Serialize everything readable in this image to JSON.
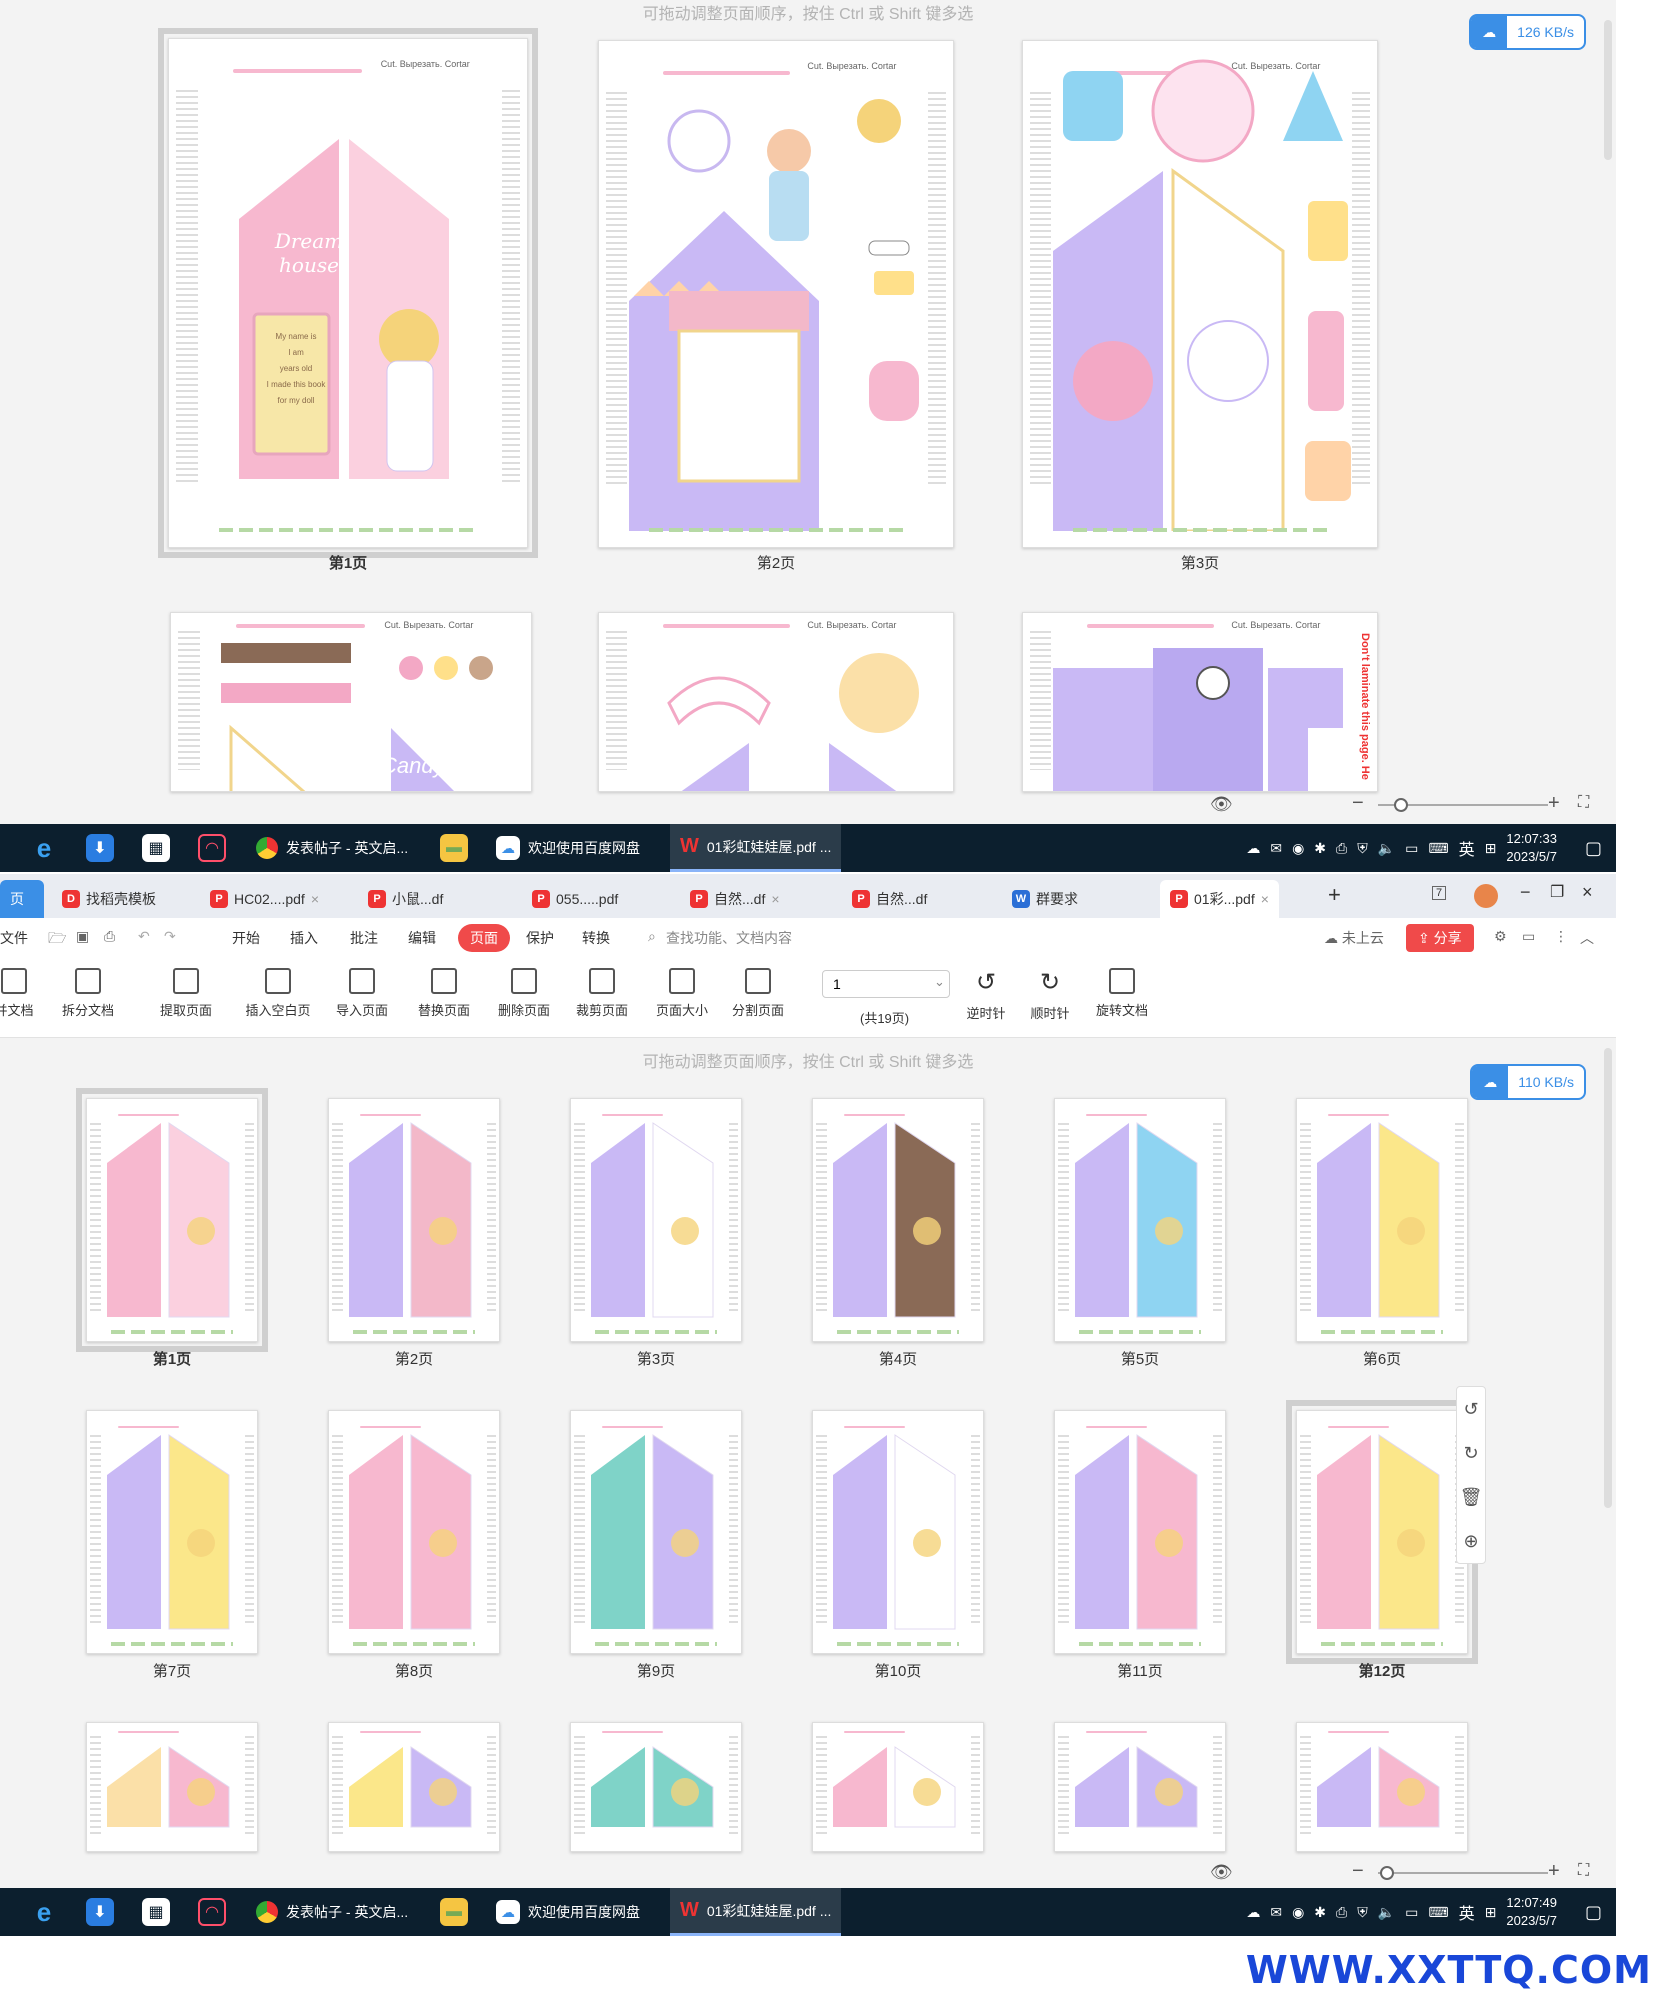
{
  "hint_text": "可拖动调整页面顺序，按住 Ctrl 或 Shift 键多选",
  "speed_top": "126 KB/s",
  "speed_bottom": "110 KB/s",
  "pages_top_row1": [
    "第1页",
    "第2页",
    "第3页"
  ],
  "pages_grid": [
    "第1页",
    "第2页",
    "第3页",
    "第4页",
    "第5页",
    "第6页",
    "第7页",
    "第8页",
    "第9页",
    "第10页",
    "第11页",
    "第12页"
  ],
  "page_header_text": "Cut. Вырезать. Cortar",
  "page_side_text": "All rights reserved. Commercial use is prohibited",
  "page_right_text": "Laminate this page. Заламинируйте эту страницу. Plastificar esta página",
  "page_right_text_alt": "Don't laminate this page. Не",
  "page1_title": "Dream house",
  "page1_card": [
    "My name is",
    "I am",
    "years old",
    "I made this book for my doll"
  ],
  "page4_candy": "Candy",
  "taskbar": {
    "apps": [
      "发表帖子 - 英文启...",
      "欢迎使用百度网盘",
      "01彩虹娃娃屋.pdf ..."
    ],
    "ime": "英",
    "time": "12:07:33",
    "time2": "12:07:49",
    "date": "2023/5/7"
  },
  "tabs": [
    {
      "label": "页",
      "color": "#3b8fe6"
    },
    {
      "label": "找稻壳模板",
      "color": "#e33"
    },
    {
      "label": "HC02....pdf",
      "color": "#e33"
    },
    {
      "label": "小鼠...df",
      "color": "#e33"
    },
    {
      "label": "055.....pdf",
      "color": "#e33"
    },
    {
      "label": "自然...df",
      "color": "#e33"
    },
    {
      "label": "自然...df",
      "color": "#e33"
    },
    {
      "label": "群要求",
      "color": "#2b6fd6"
    },
    {
      "label": "01彩...pdf",
      "color": "#e33"
    }
  ],
  "menu": [
    "文件",
    "开始",
    "插入",
    "批注",
    "编辑",
    "页面",
    "保护",
    "转换"
  ],
  "search_placeholder": "查找功能、文档内容",
  "cloud_label": "未上云",
  "share_label": "分享",
  "ribbon": [
    "并文档",
    "拆分文档",
    "提取页面",
    "插入空白页",
    "导入页面",
    "替换页面",
    "删除页面",
    "裁剪页面",
    "页面大小",
    "分割页面",
    "逆时针",
    "顺时针",
    "旋转文档"
  ],
  "page_input": "1",
  "page_total": "(共19页)",
  "watermark": "WWW.XXTTQ.COM",
  "colors": {
    "accent": "#3b8fe6",
    "share": "#f04a4a",
    "taskbar": "#0c1f2e",
    "pink": "#f7b8cf",
    "lavender": "#b9a9f0"
  }
}
